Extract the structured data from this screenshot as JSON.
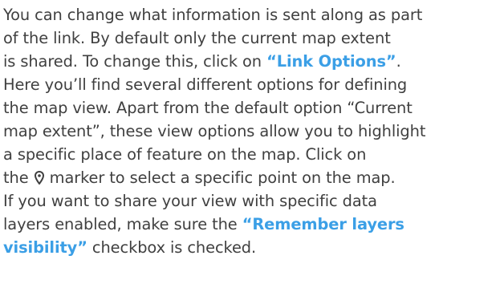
{
  "paragraph": {
    "l1": "You can change what information is sent along as part",
    "l2": "of the link. By default only the current map extent",
    "l3_a": "is shared. To change this, click on ",
    "l3_link": "“Link Options”",
    "l3_b": ".",
    "l4": "Here you’ll find several different options for defining",
    "l5": "the map view. Apart from the default option “Current",
    "l6": "map extent”, these view options allow you to highlight",
    "l7": "a specific place of feature on the map. Click on",
    "l8_a": "the ",
    "l8_b": " marker to select a specific point on the map.",
    "l9": "If you want to share your view with specific data",
    "l10_a": "layers enabled, make sure the ",
    "l10_link": "“Remember layers",
    "l11_link": "visibility”",
    "l11_b": " checkbox is checked."
  },
  "icons": {
    "marker": "map-marker-icon"
  },
  "colors": {
    "text": "#404040",
    "highlight": "#3b9fe6"
  }
}
